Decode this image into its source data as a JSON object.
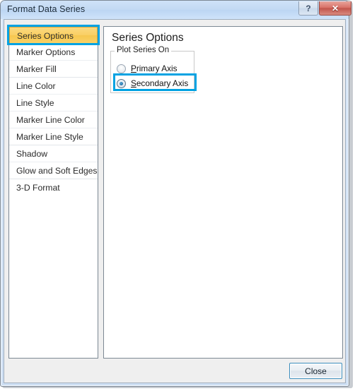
{
  "window": {
    "title": "Format Data Series",
    "help_button_label": "?",
    "close_button_label": "✕"
  },
  "sidebar": {
    "items": [
      {
        "label": "Series Options",
        "selected": true
      },
      {
        "label": "Marker Options",
        "selected": false
      },
      {
        "label": "Marker Fill",
        "selected": false
      },
      {
        "label": "Line Color",
        "selected": false
      },
      {
        "label": "Line Style",
        "selected": false
      },
      {
        "label": "Marker Line Color",
        "selected": false
      },
      {
        "label": "Marker Line Style",
        "selected": false
      },
      {
        "label": "Shadow",
        "selected": false
      },
      {
        "label": "Glow and Soft Edges",
        "selected": false
      },
      {
        "label": "3-D Format",
        "selected": false
      }
    ]
  },
  "content": {
    "heading": "Series Options",
    "group": {
      "legend": "Plot Series On",
      "options": [
        {
          "accel": "P",
          "rest": "rimary Axis",
          "full_label": "Primary Axis",
          "checked": false
        },
        {
          "accel": "S",
          "rest": "econdary Axis",
          "full_label": "Secondary Axis",
          "checked": true
        }
      ]
    }
  },
  "footer": {
    "close_label": "Close"
  },
  "colors": {
    "highlight_ring": "#00a2e2",
    "selected_item": "#f9cf63",
    "titlebar": "#c2d9f3",
    "close_button_red": "#c2554c"
  }
}
